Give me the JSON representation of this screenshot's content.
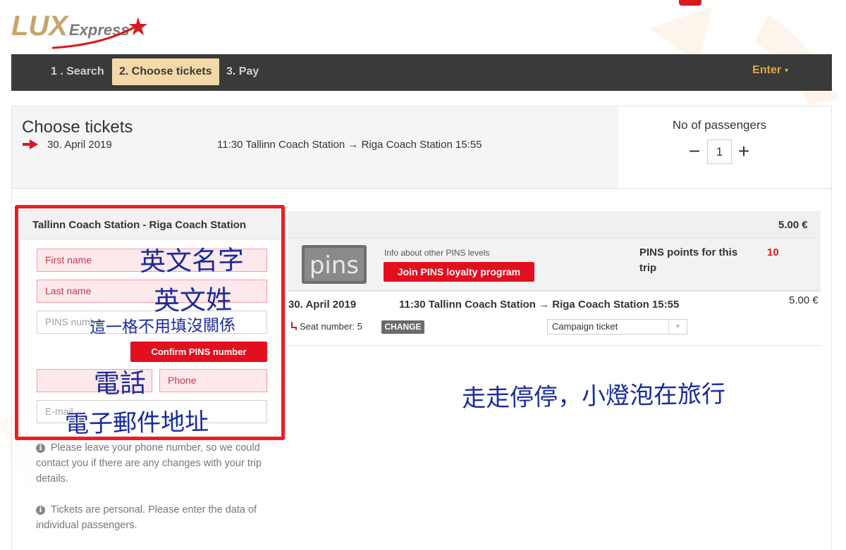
{
  "brand": {
    "logo_lux": "LUX",
    "logo_express": "Express"
  },
  "colors": {
    "accent_red": "#e2101e",
    "nav_bg": "#3a3a3a",
    "active_step": "#f4d9a8",
    "enter_color": "#e0a44a",
    "annotation_blue": "#1a2c9c"
  },
  "nav": {
    "steps": [
      "1 . Search",
      "2. Choose tickets",
      "3. Pay"
    ],
    "active_index": 1,
    "enter_label": "Enter"
  },
  "header": {
    "title": "Choose tickets",
    "date": "30. April 2019",
    "route": "11:30 Tallinn Coach Station → Riga Coach Station 15:55",
    "arrow_icon": "red-arrow-right-icon"
  },
  "passengers": {
    "label": "No of passengers",
    "count": "1",
    "minus": "−",
    "plus": "+"
  },
  "form": {
    "title": "Tallinn Coach Station - Riga Coach Station",
    "first_name": "First name",
    "last_name": "Last name",
    "pins_number": "PINS number",
    "confirm_button": "Confirm PINS number",
    "phone": "Phone",
    "email": "E-mail"
  },
  "notes": {
    "phone_note": "Please leave your phone number, so we could contact you if there are any changes with your trip details.",
    "personal_note": "Tickets are personal. Please enter the data of individual passengers."
  },
  "segment": {
    "price": "5.00 €",
    "pins_logo_text": "pins",
    "pins_info_link": "Info about other PINS levels",
    "join_button": "Join PINS loyalty program",
    "points_label": "PINS points for this trip",
    "points_value": "10",
    "leg_date": "30. April 2019",
    "leg_route": "11:30 Tallinn Coach Station → Riga Coach Station 15:55",
    "leg_price": "5.00 €",
    "seat_text": "Seat number: 5",
    "change_button": "CHANGE",
    "ticket_type": "Campaign ticket"
  },
  "annotations": {
    "first_name": "英文名字",
    "last_name": "英文姓",
    "pins": "這一格不用填沒關係",
    "phone": "電話",
    "email": "電子郵件地址",
    "watermark": "走走停停，小燈泡在旅行"
  }
}
